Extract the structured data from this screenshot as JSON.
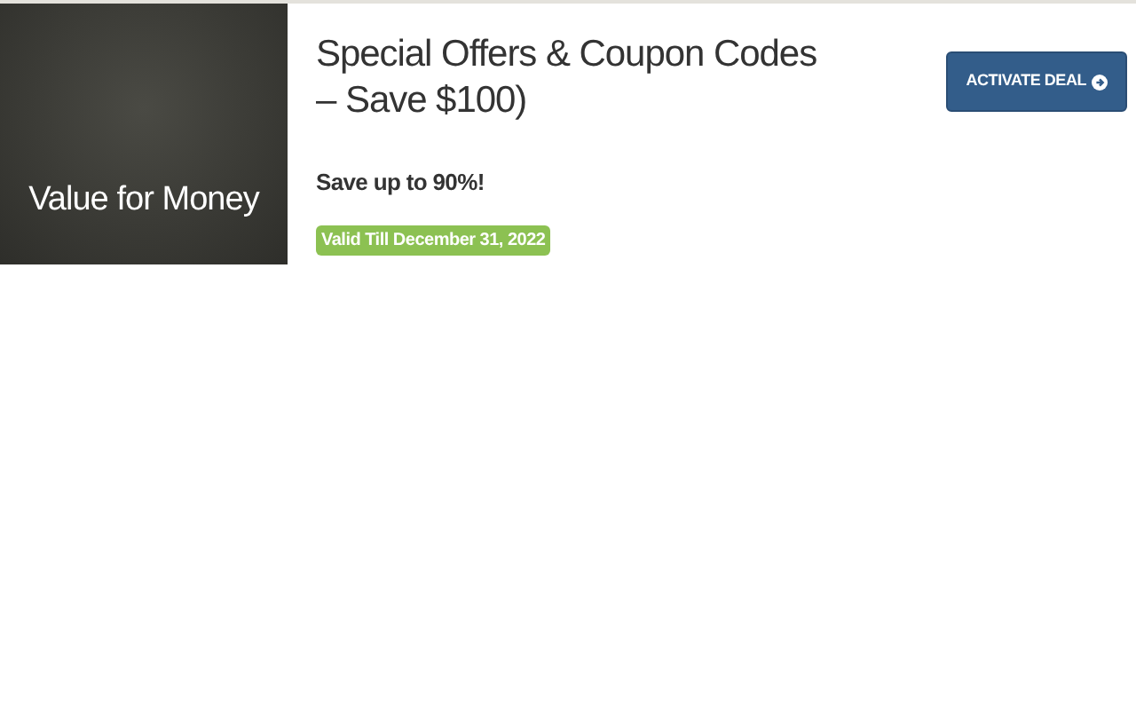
{
  "offer": {
    "tile_label": "Value for Money",
    "title": "Special Offers & Coupon Codes – Save $100)",
    "description": "Save up to 90%!",
    "validity": "Valid Till December 31, 2022",
    "button": "ACTIVATE DEAL"
  }
}
